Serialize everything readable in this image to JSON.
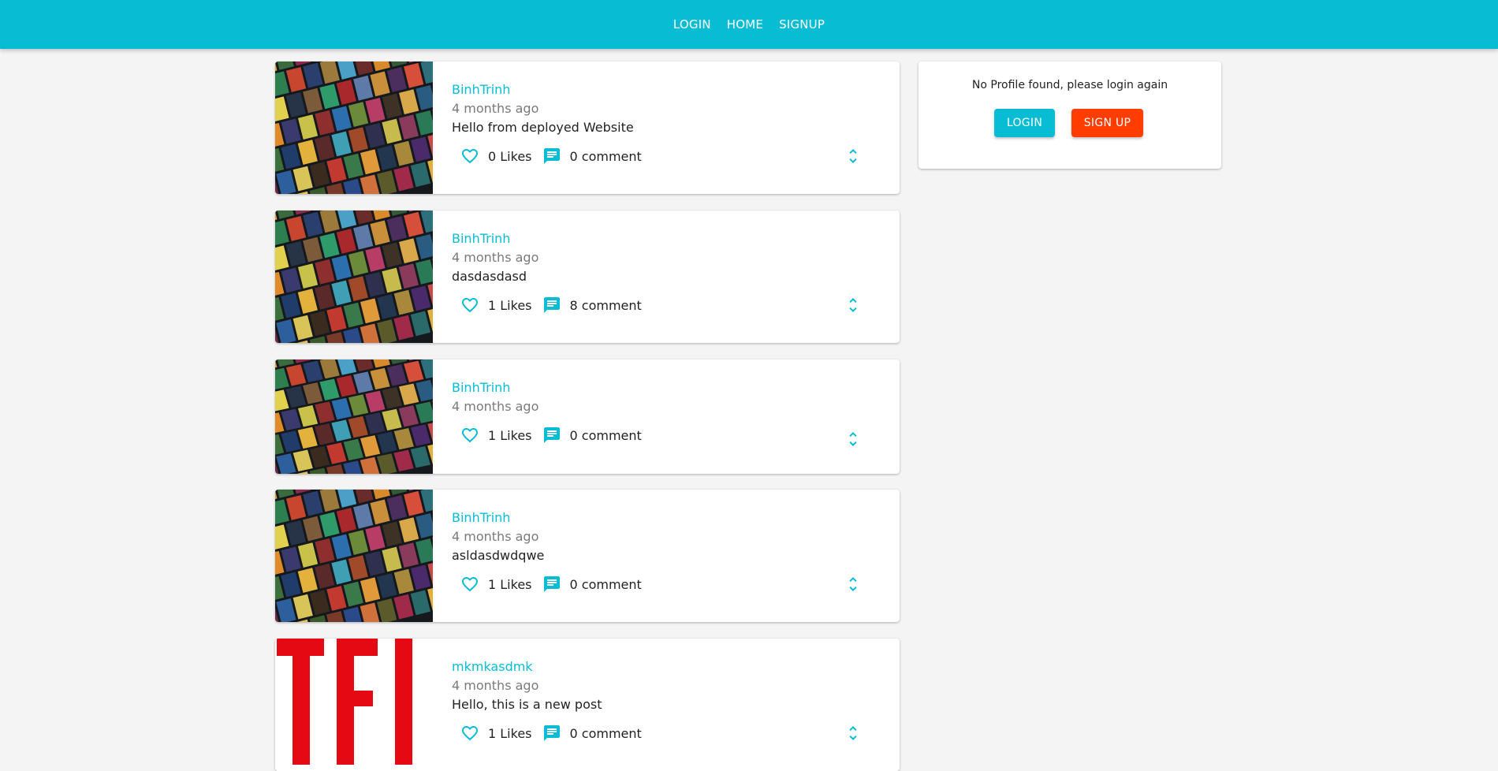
{
  "nav": {
    "items": [
      {
        "label": "LOGIN"
      },
      {
        "label": "HOME"
      },
      {
        "label": "SIGNUP"
      }
    ]
  },
  "colors": {
    "primary": "#08bcd4",
    "accent": "#ff3d00",
    "background": "#f4f4f4"
  },
  "posts": [
    {
      "handle": "BinhTrinh",
      "time": "4 months ago",
      "body": "Hello from deployed Website",
      "likes": "0 Likes",
      "comments": "0 comment",
      "image": "movie-posters-collage"
    },
    {
      "handle": "BinhTrinh",
      "time": "4 months ago",
      "body": "dasdasdasd",
      "likes": "1 Likes",
      "comments": "8 comment",
      "image": "movie-posters-collage"
    },
    {
      "handle": "BinhTrinh",
      "time": "4 months ago",
      "body": "",
      "likes": "1 Likes",
      "comments": "0 comment",
      "image": "movie-posters-collage"
    },
    {
      "handle": "BinhTrinh",
      "time": "4 months ago",
      "body": "asldasdwdqwe",
      "likes": "1 Likes",
      "comments": "0 comment",
      "image": "movie-posters-collage"
    },
    {
      "handle": "mkmkasdmk",
      "time": "4 months ago",
      "body": "Hello, this is a new post",
      "likes": "1 Likes",
      "comments": "0 comment",
      "image": "red-tfi-logo"
    }
  ],
  "icons": {
    "like": "heart-outline-icon",
    "comment": "chat-bubble-icon",
    "expand": "unfold-more-icon"
  },
  "profile": {
    "message": "No Profile found, please login again",
    "login_label": "LOGIN",
    "signup_label": "SIGN UP"
  }
}
